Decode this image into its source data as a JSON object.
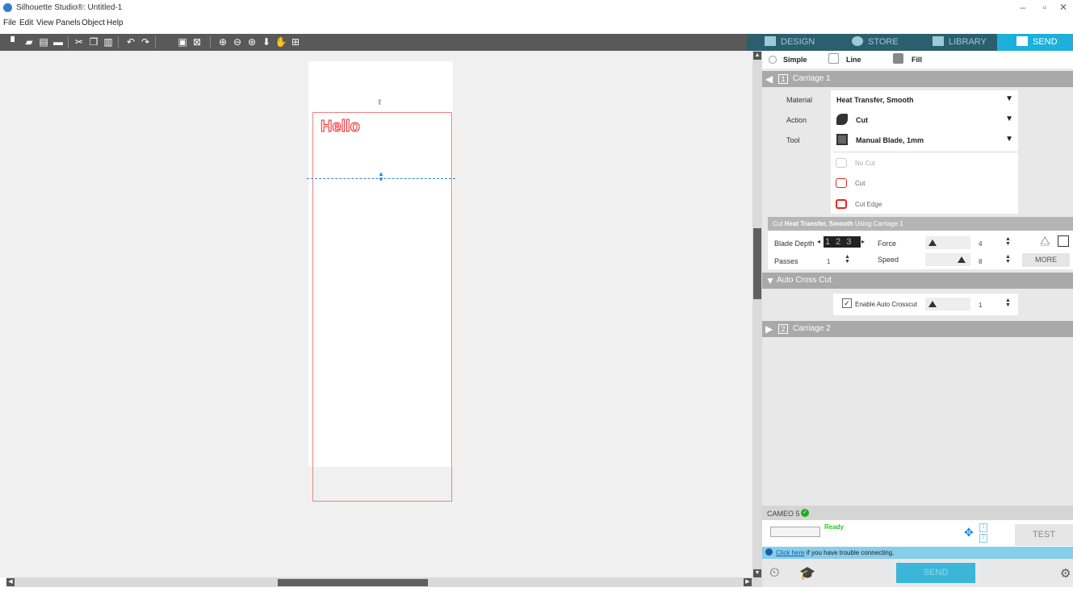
{
  "window": {
    "title": "Silhouette Studio®: Untitled-1"
  },
  "menu": [
    "File",
    "Edit",
    "View",
    "Panels",
    "Object",
    "Help"
  ],
  "tabs": [
    {
      "label": "DESIGN",
      "icon": "grid-icon"
    },
    {
      "label": "STORE",
      "icon": "store-icon"
    },
    {
      "label": "LIBRARY",
      "icon": "library-icon"
    },
    {
      "label": "SEND",
      "icon": "send-icon",
      "active": true
    }
  ],
  "canvas": {
    "text": "Hello",
    "cut_color": "#ee2222"
  },
  "send_panel": {
    "modes": [
      "Simple",
      "Line",
      "Fill"
    ],
    "carriage1": {
      "num": "1",
      "label": "Carriage 1",
      "material_label": "Material",
      "material_value": "Heat Transfer, Smooth",
      "action_label": "Action",
      "action_value": "Cut",
      "tool_label": "Tool",
      "tool_value": "Manual Blade, 1mm",
      "cut_options": [
        "No Cut",
        "Cut",
        "Cut Edge"
      ]
    },
    "cut_summary_prefix": "Cut ",
    "cut_summary_material": "Heat Transfer, Smooth",
    "cut_summary_suffix": " Using Carriage 1",
    "settings": {
      "blade_depth_label": "Blade Depth",
      "blade_depth_value": "1 2 3",
      "force_label": "Force",
      "force_value": "4",
      "passes_label": "Passes",
      "passes_value": "1",
      "speed_label": "Speed",
      "speed_value": "8",
      "more_label": "MORE"
    },
    "auto_cross_cut": {
      "label": "Auto Cross Cut",
      "enable_label": "Enable Auto Crosscut",
      "enabled": true,
      "value": "1"
    },
    "carriage2": {
      "num": "2",
      "label": "Carriage 2"
    },
    "device": {
      "name": "CAMEO 5",
      "status": "Ready",
      "test_label": "TEST",
      "status_color": "#22cc22"
    },
    "info": {
      "link": "Click here",
      "text": " if you have trouble connecting."
    },
    "send_label": "SEND"
  }
}
